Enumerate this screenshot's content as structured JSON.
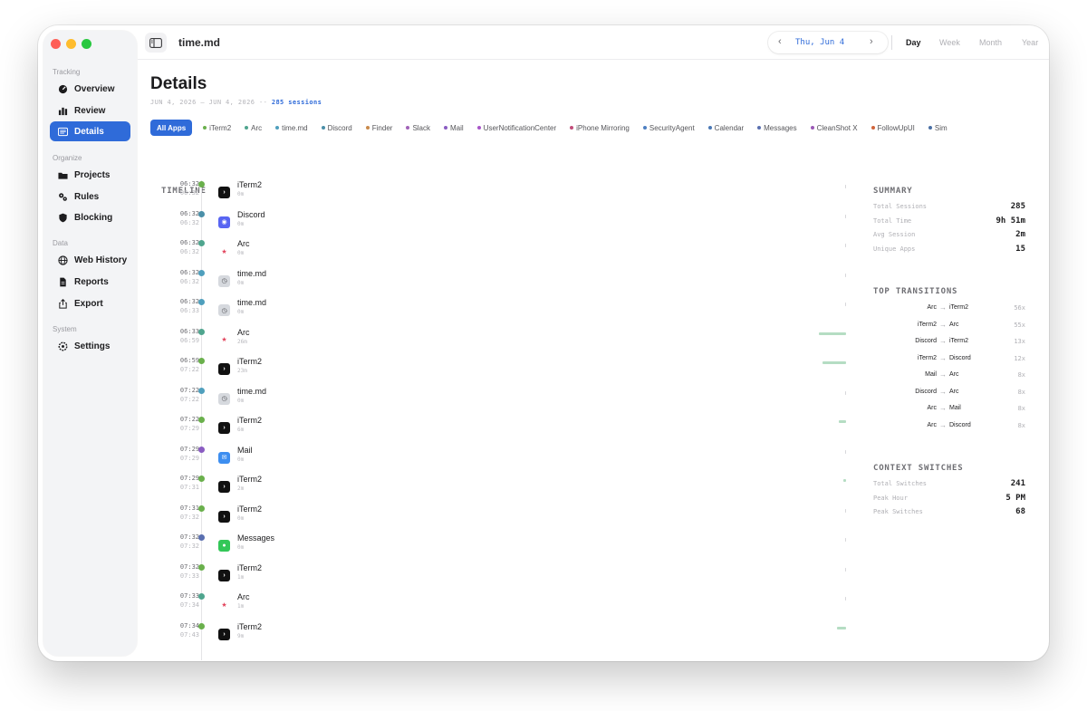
{
  "window": {
    "title": "time.md",
    "traffic_colors": [
      "#fe5f57",
      "#febc2e",
      "#28c840"
    ]
  },
  "accent": "#2f6bd9",
  "sidebar": {
    "sections": [
      {
        "label": "Tracking",
        "items": [
          {
            "label": "Overview",
            "icon": "gauge-icon"
          },
          {
            "label": "Review",
            "icon": "bar-chart-icon"
          },
          {
            "label": "Details",
            "icon": "list-icon",
            "active": true
          }
        ]
      },
      {
        "label": "Organize",
        "items": [
          {
            "label": "Projects",
            "icon": "folder-icon"
          },
          {
            "label": "Rules",
            "icon": "gears-icon"
          },
          {
            "label": "Blocking",
            "icon": "shield-icon"
          }
        ]
      },
      {
        "label": "Data",
        "items": [
          {
            "label": "Web History",
            "icon": "globe-icon"
          },
          {
            "label": "Reports",
            "icon": "document-icon"
          },
          {
            "label": "Export",
            "icon": "share-icon"
          }
        ]
      },
      {
        "label": "System",
        "items": [
          {
            "label": "Settings",
            "icon": "gear-icon"
          }
        ]
      }
    ]
  },
  "topbar": {
    "prev": "‹",
    "next": "›",
    "date": "Thu, Jun 4",
    "ranges": [
      {
        "label": "Day",
        "selected": true
      },
      {
        "label": "Week"
      },
      {
        "label": "Month"
      },
      {
        "label": "Year"
      }
    ]
  },
  "page": {
    "title": "Details",
    "date_range": "JUN 4, 2026 – JUN 4, 2026 --",
    "sessions": "285 sessions"
  },
  "filters": [
    {
      "label": "All Apps",
      "all": true
    },
    {
      "label": "iTerm2",
      "color": "#6ab04c"
    },
    {
      "label": "Arc",
      "color": "#4fa58e"
    },
    {
      "label": "time.md",
      "color": "#4f9fbd"
    },
    {
      "label": "Discord",
      "color": "#4a8fa8"
    },
    {
      "label": "Finder",
      "color": "#c98a4b"
    },
    {
      "label": "Slack",
      "color": "#a162b8"
    },
    {
      "label": "Mail",
      "color": "#8a5cc2"
    },
    {
      "label": "UserNotificationCenter",
      "color": "#a855c8"
    },
    {
      "label": "iPhone Mirroring",
      "color": "#c24d7a"
    },
    {
      "label": "SecurityAgent",
      "color": "#4d7fc2"
    },
    {
      "label": "Calendar",
      "color": "#4a78b5"
    },
    {
      "label": "Messages",
      "color": "#5a6fb0"
    },
    {
      "label": "CleanShot X",
      "color": "#9b59b6"
    },
    {
      "label": "FollowUpUI",
      "color": "#d0643a"
    },
    {
      "label": "Sim",
      "color": "#4a6fa5"
    }
  ],
  "timeline": {
    "heading": "TIMELINE",
    "rows": [
      {
        "start": "06:32",
        "end": "06:32",
        "app": "iTerm2",
        "duration": "0m",
        "color": "#6ab04c",
        "icon": "terminal-icon",
        "bar_width": 2
      },
      {
        "start": "06:32",
        "end": "06:32",
        "app": "Discord",
        "duration": "0m",
        "color": "#4a8fa8",
        "icon": "discord-icon",
        "bar_width": 2
      },
      {
        "start": "06:32",
        "end": "06:32",
        "app": "Arc",
        "duration": "0m",
        "color": "#4fa58e",
        "icon": "arc-icon",
        "bar_width": 2
      },
      {
        "start": "06:32",
        "end": "06:32",
        "app": "time.md",
        "duration": "0m",
        "color": "#4f9fbd",
        "icon": "clock-icon",
        "bar_width": 2
      },
      {
        "start": "06:32",
        "end": "06:33",
        "app": "time.md",
        "duration": "0m",
        "color": "#4f9fbd",
        "icon": "clock-icon",
        "bar_width": 2
      },
      {
        "start": "06:33",
        "end": "06:59",
        "app": "Arc",
        "duration": "26m",
        "color": "#4fa58e",
        "icon": "arc-icon",
        "bar_width": 30
      },
      {
        "start": "06:59",
        "end": "07:22",
        "app": "iTerm2",
        "duration": "23m",
        "color": "#6ab04c",
        "icon": "terminal-icon",
        "bar_width": 26
      },
      {
        "start": "07:22",
        "end": "07:22",
        "app": "time.md",
        "duration": "0m",
        "color": "#4f9fbd",
        "icon": "clock-icon",
        "bar_width": 2
      },
      {
        "start": "07:22",
        "end": "07:29",
        "app": "iTerm2",
        "duration": "6m",
        "color": "#6ab04c",
        "icon": "terminal-icon",
        "bar_width": 8
      },
      {
        "start": "07:29",
        "end": "07:29",
        "app": "Mail",
        "duration": "0m",
        "color": "#8a5cc2",
        "icon": "mail-icon",
        "bar_width": 2
      },
      {
        "start": "07:29",
        "end": "07:31",
        "app": "iTerm2",
        "duration": "2m",
        "color": "#6ab04c",
        "icon": "terminal-icon",
        "bar_width": 3
      },
      {
        "start": "07:31",
        "end": "07:32",
        "app": "iTerm2",
        "duration": "0m",
        "color": "#6ab04c",
        "icon": "terminal-icon",
        "bar_width": 2
      },
      {
        "start": "07:32",
        "end": "07:32",
        "app": "Messages",
        "duration": "0m",
        "color": "#5a6fb0",
        "icon": "messages-icon",
        "bar_width": 2
      },
      {
        "start": "07:32",
        "end": "07:33",
        "app": "iTerm2",
        "duration": "1m",
        "color": "#6ab04c",
        "icon": "terminal-icon",
        "bar_width": 2
      },
      {
        "start": "07:33",
        "end": "07:34",
        "app": "Arc",
        "duration": "1m",
        "color": "#4fa58e",
        "icon": "arc-icon",
        "bar_width": 2
      },
      {
        "start": "07:34",
        "end": "07:43",
        "app": "iTerm2",
        "duration": "9m",
        "color": "#6ab04c",
        "icon": "terminal-icon",
        "bar_width": 10
      }
    ]
  },
  "summary": {
    "heading": "SUMMARY",
    "rows": [
      {
        "label": "Total Sessions",
        "value": "285"
      },
      {
        "label": "Total Time",
        "value": "9h 51m"
      },
      {
        "label": "Avg Session",
        "value": "2m"
      },
      {
        "label": "Unique Apps",
        "value": "15"
      }
    ]
  },
  "transitions": {
    "heading": "TOP TRANSITIONS",
    "arrow": "→",
    "rows": [
      {
        "from": "Arc",
        "to": "iTerm2",
        "count": "56x"
      },
      {
        "from": "iTerm2",
        "to": "Arc",
        "count": "55x"
      },
      {
        "from": "Discord",
        "to": "iTerm2",
        "count": "13x"
      },
      {
        "from": "iTerm2",
        "to": "Discord",
        "count": "12x"
      },
      {
        "from": "Mail",
        "to": "Arc",
        "count": "8x"
      },
      {
        "from": "Discord",
        "to": "Arc",
        "count": "8x"
      },
      {
        "from": "Arc",
        "to": "Mail",
        "count": "8x"
      },
      {
        "from": "Arc",
        "to": "Discord",
        "count": "8x"
      }
    ]
  },
  "context_switches": {
    "heading": "CONTEXT SWITCHES",
    "rows": [
      {
        "label": "Total Switches",
        "value": "241"
      },
      {
        "label": "Peak Hour",
        "value": "5 PM"
      },
      {
        "label": "Peak Switches",
        "value": "68"
      }
    ]
  }
}
